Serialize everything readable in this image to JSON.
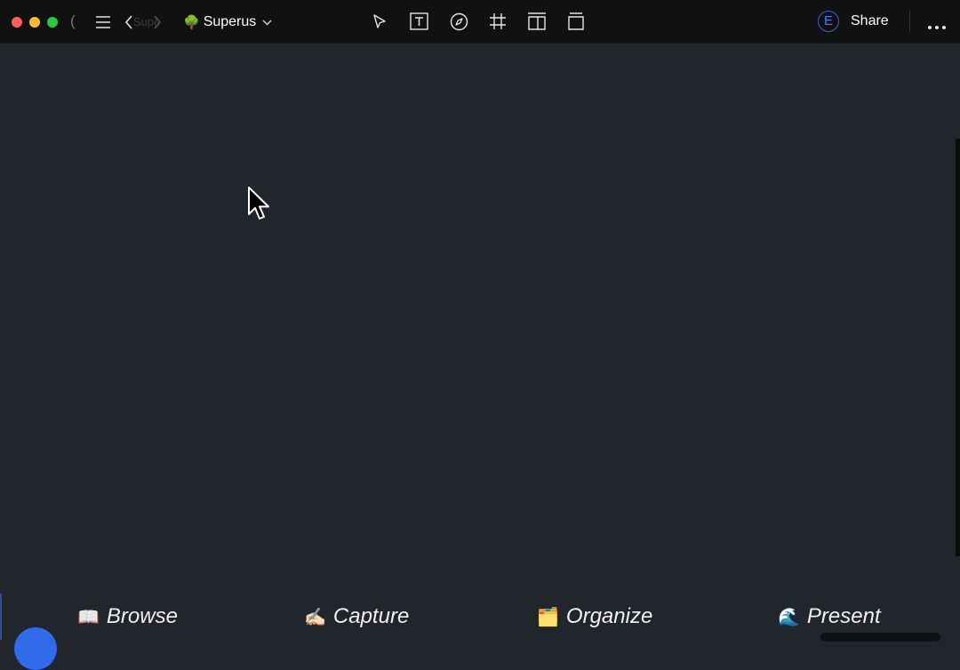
{
  "titlebar": {
    "ghost_paren": "(",
    "ghost_workspace": "Supe",
    "workspace_emoji": "🌳",
    "workspace_name": "Superus",
    "avatar_letter": "E",
    "share_label": "Share"
  },
  "toolbar": {
    "icons": [
      "select-icon",
      "text-icon",
      "compass-icon",
      "frame-icon",
      "panel-icon",
      "card-icon"
    ]
  },
  "bottom_nav": [
    {
      "emoji": "📖",
      "label": "Browse"
    },
    {
      "emoji": "✍🏻",
      "label": "Capture"
    },
    {
      "emoji": "🗂️",
      "label": "Organize"
    },
    {
      "emoji": "🌊",
      "label": "Present"
    }
  ],
  "colors": {
    "titlebar_bg": "#111111",
    "canvas_bg": "#21252c",
    "accent": "#2f6bea",
    "close": "#fe5f57",
    "minimize": "#febc2e",
    "maximize": "#28c840"
  }
}
